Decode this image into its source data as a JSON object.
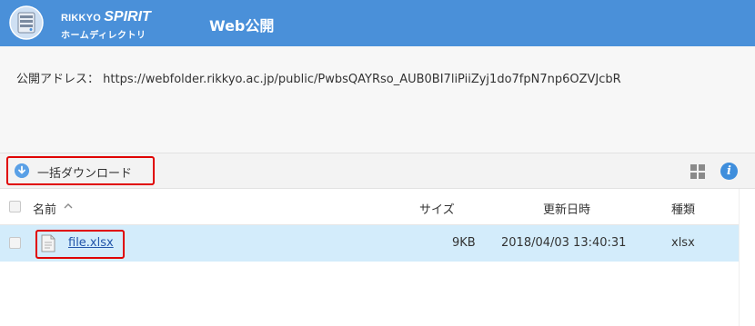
{
  "header": {
    "logo_top_prefix": "RIKKYO",
    "logo_top_brand": "SPIRIT",
    "logo_bottom": "ホームディレクトリ",
    "title": "Web公開",
    "background_color": "#4a90d9"
  },
  "address": {
    "label": "公開アドレス：",
    "url": "https://webfolder.rikkyo.ac.jp/public/PwbsQAYRso_AUB0BI7liPiiZyj1do7fpN7np6OZVJcbR"
  },
  "toolbar": {
    "download_label": "一括ダウンロード",
    "download_icon": "download-arrow-circle-icon",
    "view_icon": "grid-view-icon",
    "info_icon": "info-icon",
    "info_glyph": "i"
  },
  "table": {
    "columns": {
      "name": "名前",
      "size": "サイズ",
      "modified": "更新日時",
      "type": "種類"
    },
    "sort_indicator": "ascending",
    "rows": [
      {
        "name": "file.xlsx",
        "size": "9KB",
        "modified": "2018/04/03 13:40:31",
        "type": "xlsx",
        "selected_highlight": true
      }
    ]
  },
  "colors": {
    "row_highlight": "#d3ecfb",
    "annotation_red": "#e00000",
    "link": "#2255aa"
  }
}
